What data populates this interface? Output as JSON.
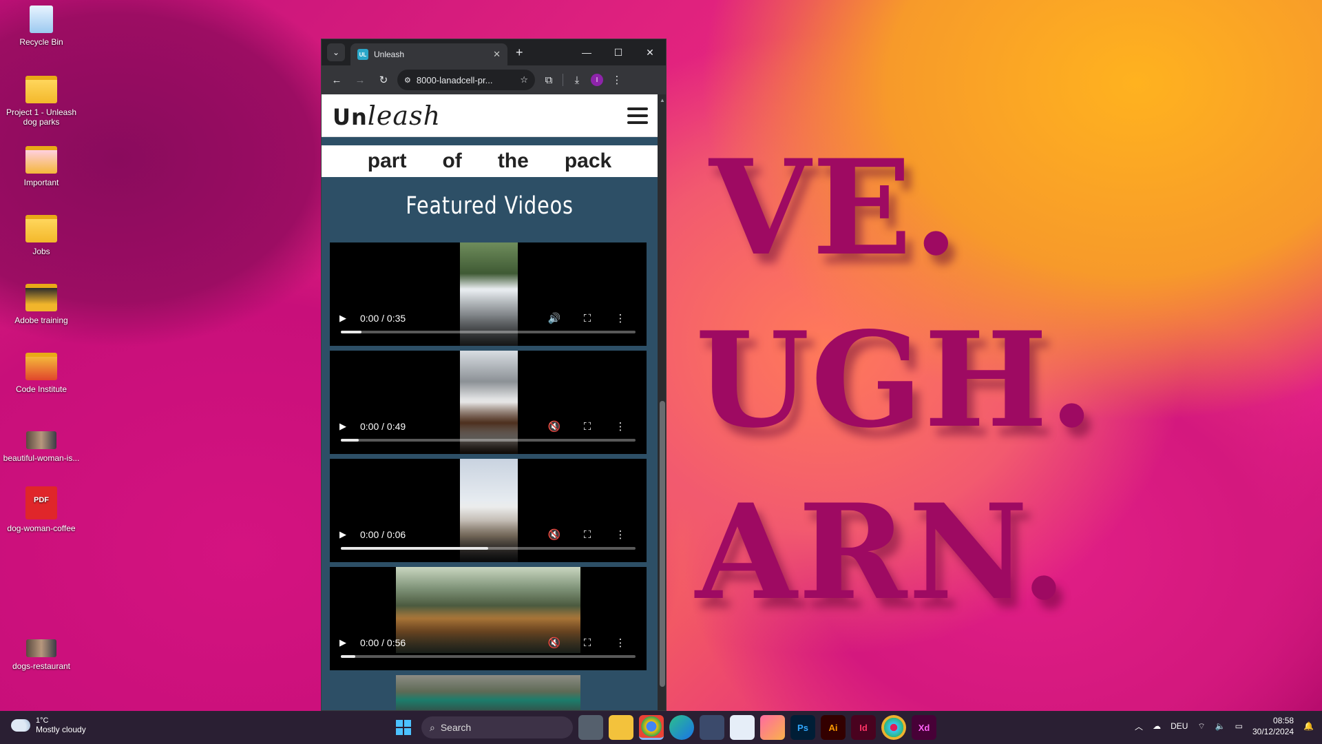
{
  "desktop": {
    "wallpaper_words": [
      "VE.",
      "UGH.",
      "ARN."
    ],
    "icons": [
      {
        "label": "Recycle Bin",
        "icon": "recycle-bin-icon"
      },
      {
        "label": "Project 1 - Unleash dog parks",
        "icon": "folder-icon"
      },
      {
        "label": "Important",
        "icon": "folder-icon"
      },
      {
        "label": "Jobs",
        "icon": "folder-icon"
      },
      {
        "label": "Adobe training",
        "icon": "folder-icon"
      },
      {
        "label": "Code Institute",
        "icon": "folder-icon"
      },
      {
        "label": "beautiful-woman-is...",
        "icon": "image-file-icon"
      },
      {
        "label": "dog-woman-coffee",
        "icon": "pdf-file-icon",
        "badge": "PDF"
      },
      {
        "label": "dogs-restaurant",
        "icon": "image-file-icon"
      }
    ]
  },
  "browser": {
    "tab": {
      "favicon": "UL",
      "title": "Unleash"
    },
    "new_tab": "+",
    "window_controls": [
      "—",
      "☐",
      "✕"
    ],
    "toolbar": {
      "url": "8000-lanadcell-pr...",
      "profile_initial": "I"
    }
  },
  "page": {
    "logo_un": "Un",
    "logo_rest": "leash",
    "tagline": [
      "part",
      "of",
      "the",
      "pack"
    ],
    "section_title": "Featured Videos",
    "videos": [
      {
        "time": "0:00 / 0:35",
        "muted": false,
        "progress": 0.07
      },
      {
        "time": "0:00 / 0:49",
        "muted": true,
        "progress": 0.06
      },
      {
        "time": "0:00 / 0:06",
        "muted": true,
        "progress": 0.5
      },
      {
        "time": "0:00 / 0:56",
        "muted": true,
        "progress": 0.05
      }
    ]
  },
  "taskbar": {
    "weather_temp": "1°C",
    "weather_desc": "Mostly cloudy",
    "search_placeholder": "Search",
    "apps": [
      "Ps",
      "Ai",
      "Id",
      "Xd"
    ],
    "language": "DEU",
    "time": "08:58",
    "date": "30/12/2024"
  },
  "colors": {
    "page_bg": "#2d4f66",
    "accent_profile": "#8e24aa"
  }
}
